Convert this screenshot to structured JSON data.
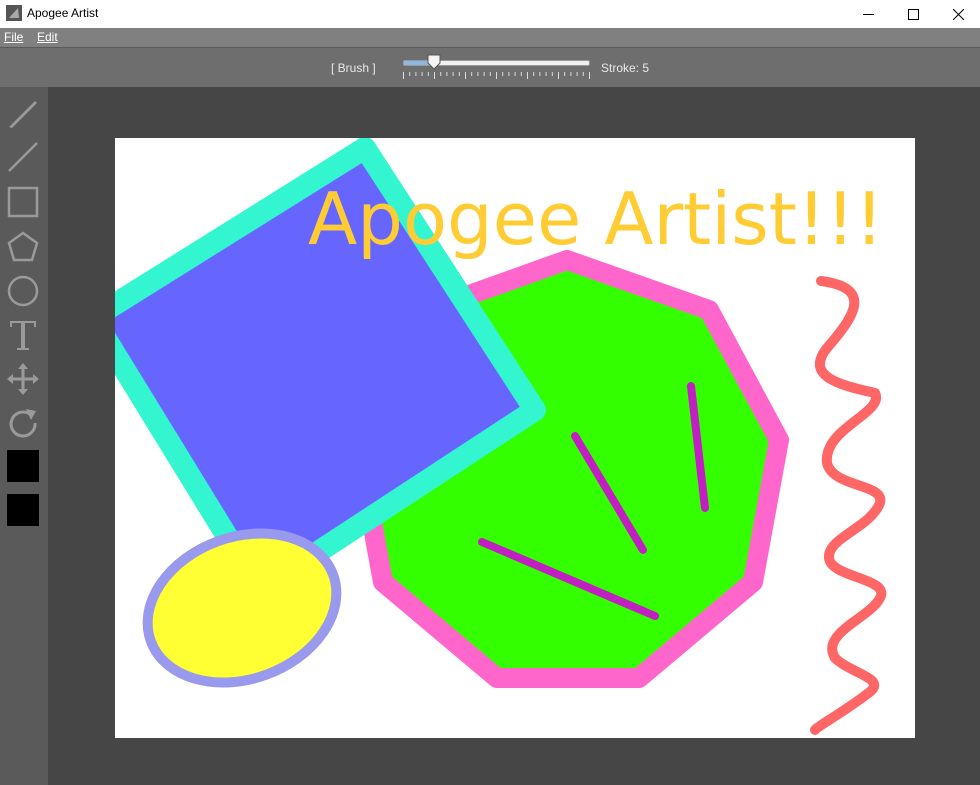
{
  "window": {
    "title": "Apogee Artist",
    "app_icon": "apogee-logo-icon",
    "controls": [
      "minimize-icon",
      "maximize-icon",
      "close-icon"
    ]
  },
  "menu": {
    "file": "File",
    "edit": "Edit"
  },
  "toolbar": {
    "mode_label": "[ Brush ]",
    "stroke_label": "Stroke: 5",
    "stroke_value": 5,
    "slider_fraction": 0.17
  },
  "tools": [
    {
      "name": "brush",
      "icon": "brush-icon"
    },
    {
      "name": "line",
      "icon": "line-icon"
    },
    {
      "name": "rectangle",
      "icon": "rectangle-icon"
    },
    {
      "name": "polygon",
      "icon": "pentagon-icon"
    },
    {
      "name": "ellipse",
      "icon": "circle-icon"
    },
    {
      "name": "text",
      "icon": "text-icon"
    },
    {
      "name": "move",
      "icon": "move-icon"
    },
    {
      "name": "rotate",
      "icon": "rotate-icon"
    }
  ],
  "colors": {
    "primary_swatch": "#000000",
    "secondary_swatch": "#000000",
    "square_fill": "#6666ff",
    "square_stroke": "#33f5d0",
    "octagon_fill": "#33ff00",
    "octagon_stroke": "#ff66cc",
    "ellipse_fill": "#ffff33",
    "ellipse_stroke": "#9999ee",
    "text_color": "#ffcc33",
    "purple_lines": "#c21fc2",
    "squiggle": "#ff6666"
  },
  "canvas": {
    "text": "Apogee Artist!!!"
  }
}
